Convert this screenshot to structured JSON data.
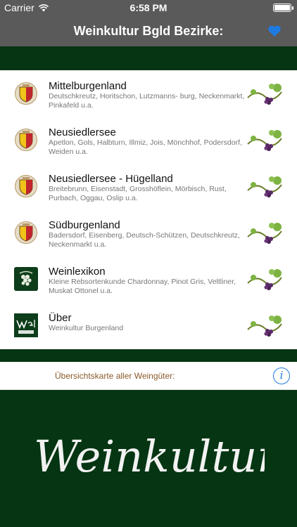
{
  "status": {
    "carrier": "Carrier",
    "time": "6:58 PM"
  },
  "navbar": {
    "title": "Weinkultur Bgld Bezirke:",
    "heart_icon": "heart-icon",
    "heart_color": "#1f7ae0"
  },
  "list": {
    "items": [
      {
        "title": "Mittelburgenland",
        "subtitle": "Deutschkreutz, Horitschon, Lutzmanns- burg, Neckenmarkt, Pinkafeld u.a.",
        "icon": "coat-of-arms-icon"
      },
      {
        "title": "Neusiedlersee",
        "subtitle": "Apetlon, Gols, Halbturn, Illmiz, Jois, Mönchhof, Podersdorf, Weiden u.a.",
        "icon": "coat-of-arms-icon"
      },
      {
        "title": "Neusiedlersee - Hügelland",
        "subtitle": "Breitebrunn, Eisenstadt, Grosshöflein, Mörbisch, Rust, Purbach, Oggau, Oslip u.a.",
        "icon": "coat-of-arms-icon"
      },
      {
        "title": "Südburgenland",
        "subtitle": "Badersdorf, Eisenberg, Deutsch-Schützen, Deutschkreutz, Neckenmarkt u.a.",
        "icon": "coat-of-arms-icon"
      },
      {
        "title": "Weinlexikon",
        "subtitle": "Kleine Rebsortenkunde Chardonnay, Pinot Gris, Veltliner, Muskat Ottonel u.a.",
        "icon": "grapes-logo-icon"
      },
      {
        "title": "Über",
        "subtitle": "Weinkultur Burgenland",
        "icon": "weinkultur-logo-icon"
      }
    ]
  },
  "overview": {
    "label": "Übersichtskarte aller Weingüter:",
    "info_glyph": "i"
  },
  "logo": {
    "text": "Weinkultur"
  },
  "colors": {
    "bar_gray": "#5a5a5a",
    "dark_green": "#053512",
    "accent_blue": "#1f7ae0",
    "overview_text": "#8a5a2a"
  }
}
